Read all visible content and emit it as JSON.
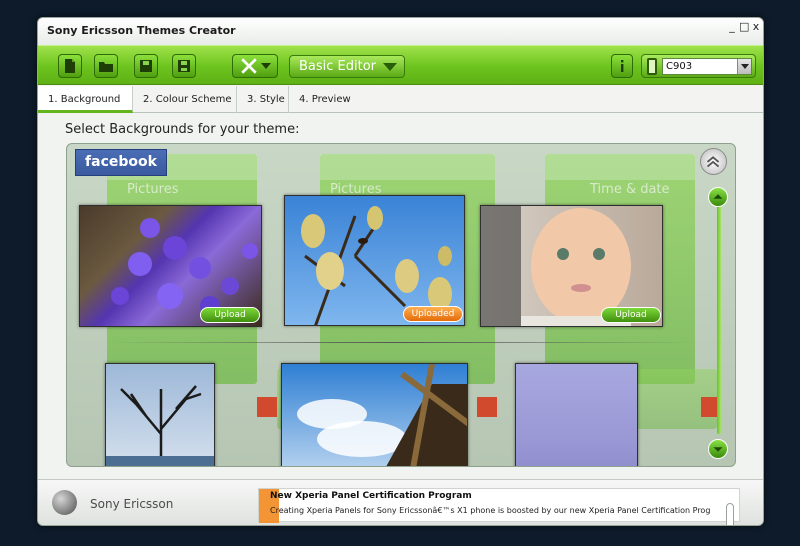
{
  "app": {
    "title": "Sony Ericsson Themes Creator",
    "window_controls": [
      "_",
      "□",
      "x"
    ]
  },
  "toolbar": {
    "buttons": [
      "new-file-icon",
      "open-folder-icon",
      "save-icon",
      "save-as-icon"
    ],
    "tools_icon": "tools-icon",
    "editor_mode": "Basic Editor",
    "info_icon": "info-icon",
    "phone_model": "C903"
  },
  "tabs": [
    {
      "label": "1. Background",
      "active": true
    },
    {
      "label": "2. Colour Scheme",
      "active": false
    },
    {
      "label": "3. Style",
      "active": false
    },
    {
      "label": "4. Preview",
      "active": false
    }
  ],
  "main": {
    "heading": "Select Backgrounds for your theme:",
    "source_label": "facebook",
    "ghost_headers": [
      "Pictures",
      "Pictures",
      "Time & date"
    ],
    "featured_images": [
      {
        "name": "purple-flowers",
        "upload_label": "Upload",
        "state": "default"
      },
      {
        "name": "pussy-willow-bee",
        "upload_label": "Uploaded",
        "state": "uploaded"
      },
      {
        "name": "baby-portrait",
        "upload_label": "Upload",
        "state": "default"
      }
    ],
    "library_images": [
      "bare-tree",
      "windmill-clouds",
      "purple-sky"
    ]
  },
  "footer": {
    "brand": "Sony Ericsson",
    "news_title": "New Xperia Panel Certification Program",
    "news_body": "Creating Xperia Panels for Sony Ericssonâ€™s X1 phone is boosted by our new Xperia Panel Certification Program,..."
  },
  "colors": {
    "accent_green": "#6cc41e",
    "upload_orange": "#e46b09",
    "facebook_blue": "#3b5a9f"
  }
}
